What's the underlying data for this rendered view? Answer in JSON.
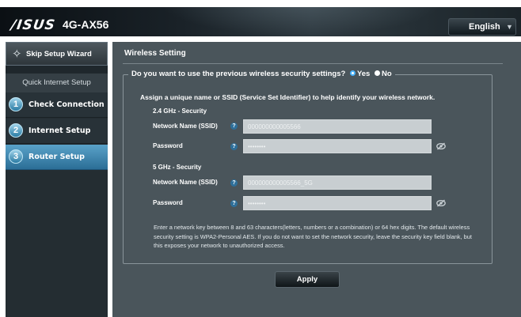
{
  "header": {
    "logo": "/ISUS",
    "model": "4G-AX56",
    "language": "English"
  },
  "sidebar": {
    "skip_label": "Skip Setup Wizard",
    "section_title": "Quick Internet Setup",
    "steps": [
      {
        "number": "1",
        "label": "Check Connection"
      },
      {
        "number": "2",
        "label": "Internet Setup"
      },
      {
        "number": "3",
        "label": "Router Setup",
        "active": true
      }
    ]
  },
  "main": {
    "title": "Wireless Setting",
    "question": "Do you want to use the previous wireless security settings?",
    "option_yes": "Yes",
    "option_no": "No",
    "selected_option": "Yes",
    "intro": "Assign a unique name or SSID (Service Set Identifier) to help identify your wireless network.",
    "band_24": {
      "heading": "2.4 GHz - Security",
      "ssid_label": "Network Name (SSID)",
      "ssid_value": "000000000005566",
      "password_label": "Password",
      "password_value": "••••••••"
    },
    "band_5": {
      "heading": "5 GHz - Security",
      "ssid_label": "Network Name (SSID)",
      "ssid_value": "000000000005566_5G",
      "password_label": "Password",
      "password_value": "••••••••"
    },
    "note": "Enter a network key between 8 and 63 characters(letters, numbers or a combination) or 64 hex digits. The default wireless security setting is WPA2-Personal AES. If you do not want to set the network security, leave the security key field blank, but this exposes your network to unauthorized access.",
    "apply_label": "Apply",
    "help_symbol": "?"
  },
  "colors": {
    "accent": "#4bb4ff",
    "active_step": "#3b86b3",
    "panel": "#4a555b"
  }
}
